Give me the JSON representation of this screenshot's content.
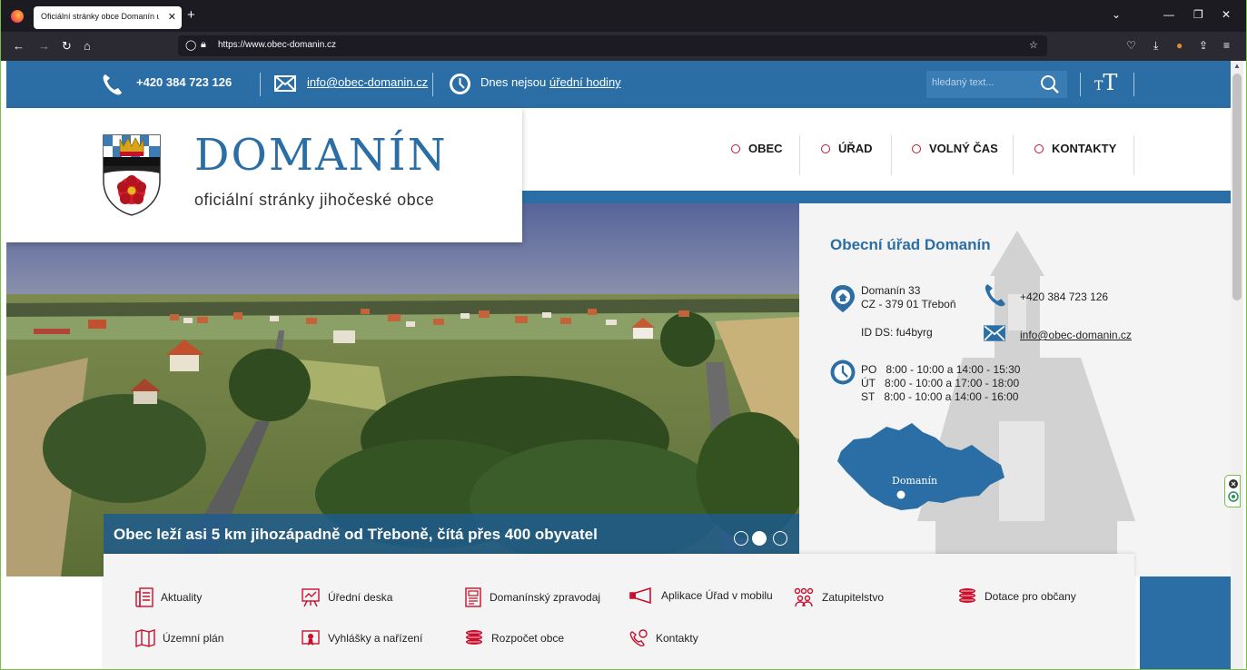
{
  "browser": {
    "tab_title": "Oficiální stránky obce Domanín u T",
    "tab_close": "✕",
    "new_tab": "+",
    "url": "https://www.obec-domanin.cz",
    "win_controls": [
      "⌄",
      "—",
      "❐",
      "✕"
    ]
  },
  "topbar": {
    "phone": "+420 384 723 126",
    "email": "info@obec-domanin.cz",
    "hours_prefix": "Dnes nejsou ",
    "hours_link": "úřední hodiny",
    "search_placeholder": "hledaný text...",
    "font_size_label": "TT"
  },
  "logo": {
    "title": "DOMANÍN",
    "subtitle": "oficiální stránky jihočeské obce"
  },
  "mainnav": {
    "items": [
      {
        "label": "OBEC"
      },
      {
        "label": "ÚŘAD"
      },
      {
        "label": "VOLNÝ ČAS"
      },
      {
        "label": "KONTAKTY"
      }
    ]
  },
  "hero": {
    "caption": "Obec leží asi 5 km jihozápadně od Třeboně, čítá přes 400 obyvatel",
    "slides_count": 3,
    "active_slide": 2
  },
  "office": {
    "title": "Obecní úřad Domanín",
    "address_line1": "Domanín 33",
    "address_line2": "CZ - 379 01 Třeboň",
    "ds": "ID DS: fu4byrg",
    "phone": "+420 384 723 126",
    "email": "info@obec-domanin.cz",
    "hours": [
      {
        "day": "PO",
        "time": "8:00 - 10:00 a 14:00 - 15:30"
      },
      {
        "day": "ÚT",
        "time": "8:00 - 10:00 a 17:00 - 18:00"
      },
      {
        "day": "ST",
        "time": "8:00 - 10:00 a 14:00 - 16:00"
      }
    ],
    "map_label": "Domanín"
  },
  "quicklinks": {
    "row1": [
      {
        "label": "Aktuality",
        "icon": "news-icon"
      },
      {
        "label": "Úřední deska",
        "icon": "board-icon"
      },
      {
        "label": "Domanínský zpravodaj",
        "icon": "newsletter-icon"
      },
      {
        "label": "Aplikace Úřad v mobilu",
        "icon": "megaphone-icon"
      },
      {
        "label": "Zatupitelstvo",
        "icon": "people-icon"
      },
      {
        "label": "Dotace pro občany",
        "icon": "coins-icon"
      }
    ],
    "row2": [
      {
        "label": "Územní plán",
        "icon": "map-icon"
      },
      {
        "label": "Vyhlášky a nařízení",
        "icon": "decree-icon"
      },
      {
        "label": "Rozpočet obce",
        "icon": "budget-icon"
      },
      {
        "label": "Kontakty",
        "icon": "phone-contact-icon"
      }
    ]
  },
  "colors": {
    "primary_blue": "#2b6ea5",
    "accent_red": "#c8102e",
    "panel_gray": "#f4f4f4"
  }
}
